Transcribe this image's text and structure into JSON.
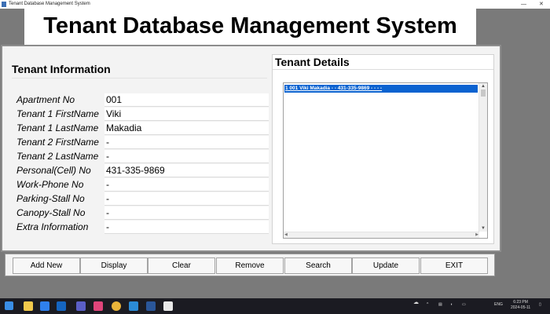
{
  "window": {
    "title": "Tenant Database Management System",
    "app_icon": "feather-icon",
    "minimize_icon": "minimize-icon",
    "close_icon": "close-icon"
  },
  "heading": "Tenant Database Management System",
  "tenant_info": {
    "title": "Tenant Information",
    "fields": [
      {
        "label": "Apartment No",
        "value": "001"
      },
      {
        "label": "Tenant 1 FirstName",
        "value": "Viki"
      },
      {
        "label": "Tenant 1 LastName",
        "value": "Makadia"
      },
      {
        "label": "Tenant 2 FirstName",
        "value": "-"
      },
      {
        "label": "Tenant 2 LastName",
        "value": "-"
      },
      {
        "label": "Personal(Cell) No",
        "value": "431-335-9869"
      },
      {
        "label": "Work-Phone No",
        "value": "-"
      },
      {
        "label": "Parking-Stall No",
        "value": "-"
      },
      {
        "label": "Canopy-Stall No",
        "value": "-"
      },
      {
        "label": "Extra Information",
        "value": "-"
      }
    ]
  },
  "tenant_details": {
    "title": "Tenant Details",
    "items": [
      "1 001 Viki Makadia - - 431-335-9869 - - - -"
    ],
    "selected_index": 0
  },
  "buttons": {
    "add_new": "Add New",
    "display": "Display",
    "clear": "Clear",
    "remove": "Remove",
    "search": "Search",
    "update": "Update",
    "exit": "EXIT"
  },
  "taskbar": {
    "icons": [
      "windows-start-icon",
      "file-explorer-icon",
      "mail-icon",
      "outlook-icon",
      "teams-icon",
      "ide-icon",
      "chrome-icon",
      "vscode-icon",
      "word-icon",
      "python-icon"
    ],
    "tray_language": "ENG",
    "clock_time": "6:23 PM",
    "clock_date": "2024-05-11"
  },
  "colors": {
    "background": "#7a7a7a",
    "selection": "#0a62d0",
    "taskbar": "#1b1b22"
  }
}
